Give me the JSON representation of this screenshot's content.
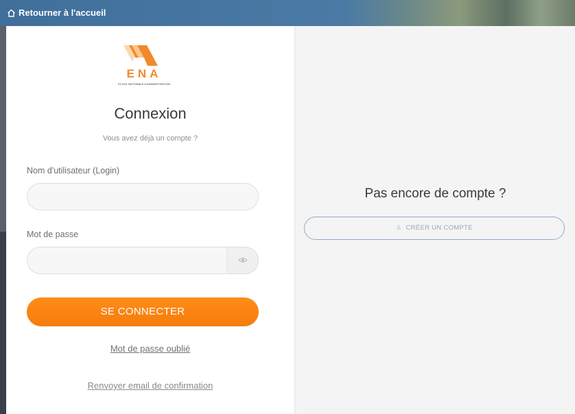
{
  "header": {
    "back_label": "Retourner à l'accueil"
  },
  "logo": {
    "letters": "ENA",
    "subtitle": "ECOLE NATIONALE D'ADMINISTRATION"
  },
  "login": {
    "title": "Connexion",
    "subtitle": "Vous avez déjà un compte ?",
    "username_label": "Nom d'utilisateur (Login)",
    "username_value": "",
    "password_label": "Mot de passe",
    "password_value": "",
    "submit_label": "SE CONNECTER",
    "forgot_label": "Mot de passe oublié",
    "resend_label": "Renvoyer email de confirmation"
  },
  "signup": {
    "question": "Pas encore de compte ?",
    "create_label": "CRÉER UN COMPTE"
  },
  "colors": {
    "accent": "#f57c0a",
    "header": "#4a7aa5",
    "outline": "#8faac4"
  }
}
